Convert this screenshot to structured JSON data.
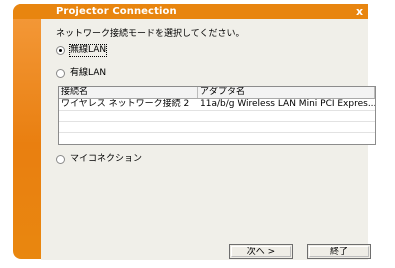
{
  "window": {
    "title": "Projector Connection",
    "close_glyph": "x"
  },
  "instruction": "ネットワーク接続モードを選択してください。",
  "options": {
    "wireless": "無線LAN",
    "wired": "有線LAN",
    "my_connection": "マイコネクション"
  },
  "table": {
    "columns": [
      "接続名",
      "アダプタ名"
    ],
    "rows": [
      [
        "ワイヤレス ネットワーク接続 2",
        "11a/b/g Wireless LAN Mini PCI Expres..."
      ]
    ]
  },
  "buttons": {
    "next": "次へ >",
    "finish": "終了"
  },
  "colors": {
    "accent": "#e8850f",
    "dialog_bg": "#f0efe9"
  }
}
